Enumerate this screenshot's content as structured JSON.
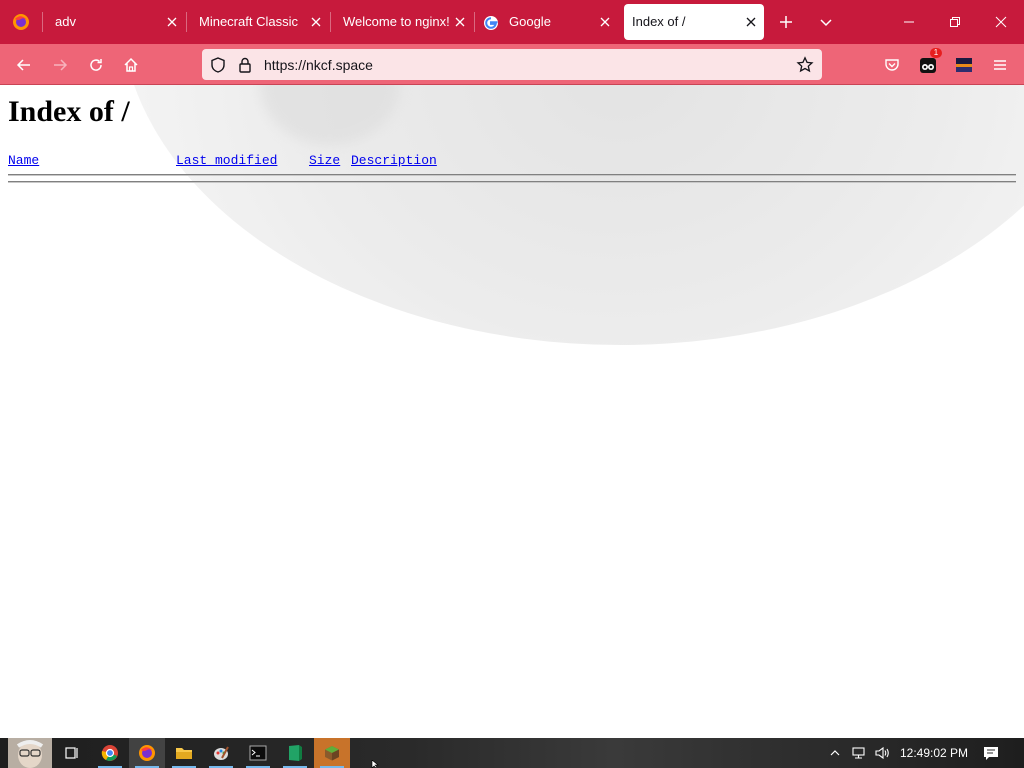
{
  "browser": {
    "tabs": [
      {
        "label": "adv"
      },
      {
        "label": "Minecraft Classic"
      },
      {
        "label": "Welcome to nginx!"
      },
      {
        "label": "Google"
      },
      {
        "label": "Index of /"
      }
    ],
    "url": "https://nkcf.space",
    "extension_badge": "1"
  },
  "page": {
    "title": "Index of /",
    "columns": [
      "Name",
      "Last modified",
      "Size",
      "Description"
    ]
  },
  "taskbar": {
    "clock": "12:49:02 PM"
  },
  "colors": {
    "tabstrip": "#c71a3c",
    "navbar": "#ee6577",
    "link": "#0000ee"
  }
}
